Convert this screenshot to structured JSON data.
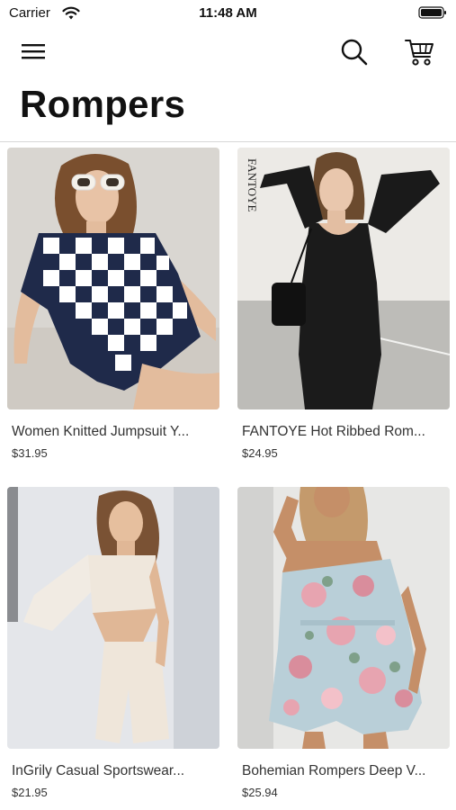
{
  "status_bar": {
    "carrier": "Carrier",
    "time": "11:48 AM"
  },
  "nav": {
    "menu_icon": "hamburger-menu-icon",
    "search_icon": "search-icon",
    "cart_icon": "cart-icon"
  },
  "page": {
    "title": "Rompers"
  },
  "products": [
    {
      "name": "Women Knitted Jumpsuit Y...",
      "price": "$31.95",
      "image": "woman in navy and white checkered romper with white sunglasses"
    },
    {
      "name": "FANTOYE Hot Ribbed Rom...",
      "price": "$24.95",
      "image": "woman in black ribbed long-sleeve romper",
      "brand_text": "FANTOYE"
    },
    {
      "name": "InGrily Casual Sportswear...",
      "price": "$21.95",
      "image": "woman in cream one-shoulder cut-out romper"
    },
    {
      "name": "Bohemian Rompers Deep V...",
      "price": "$25.94",
      "image": "woman in light blue floral off-shoulder romper"
    }
  ],
  "colors": {
    "text": "#111111",
    "secondary_text": "#333333",
    "divider": "#d8d8d8"
  }
}
